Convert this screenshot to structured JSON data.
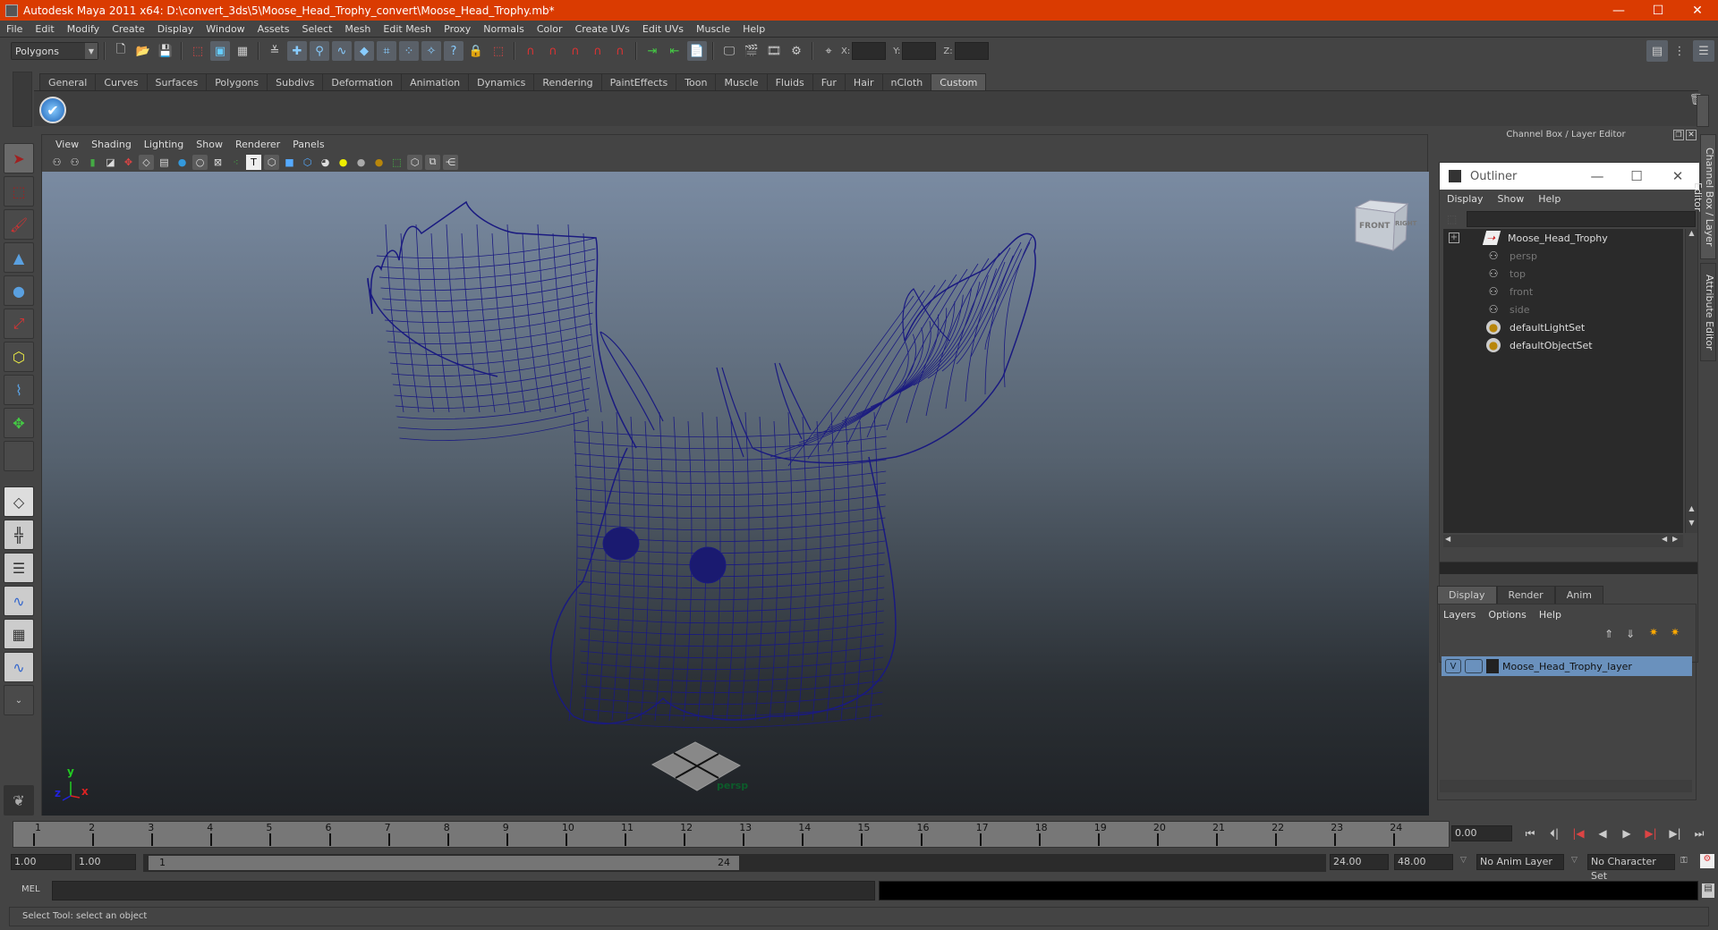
{
  "window": {
    "title": "Autodesk Maya 2011 x64: D:\\convert_3ds\\5\\Moose_Head_Trophy_convert\\Moose_Head_Trophy.mb*",
    "minimize": "—",
    "maximize": "☐",
    "close": "✕"
  },
  "menubar": [
    "File",
    "Edit",
    "Modify",
    "Create",
    "Display",
    "Window",
    "Assets",
    "Select",
    "Mesh",
    "Edit Mesh",
    "Proxy",
    "Normals",
    "Color",
    "Create UVs",
    "Edit UVs",
    "Muscle",
    "Help"
  ],
  "toolbar": {
    "mode": "Polygons",
    "x_label": "X:",
    "y_label": "Y:",
    "z_label": "Z:"
  },
  "shelf": {
    "tabs": [
      "General",
      "Curves",
      "Surfaces",
      "Polygons",
      "Subdivs",
      "Deformation",
      "Animation",
      "Dynamics",
      "Rendering",
      "PaintEffects",
      "Toon",
      "Muscle",
      "Fluids",
      "Fur",
      "Hair",
      "nCloth",
      "Custom"
    ],
    "active_tab": "Custom"
  },
  "viewport": {
    "menus": [
      "View",
      "Shading",
      "Lighting",
      "Show",
      "Renderer",
      "Panels"
    ],
    "camera": "persp",
    "viewcube_front": "FRONT",
    "viewcube_right": "RIGHT",
    "axis_labels": {
      "x": "x",
      "y": "y",
      "z": "z"
    },
    "wire_color": "#1a1a80"
  },
  "rightdock": {
    "header": "Channel Box / Layer Editor",
    "side_tabs": [
      "Channel Box / Layer Editor",
      "Attribute Editor"
    ]
  },
  "outliner": {
    "title": "Outliner",
    "menus": [
      "Display",
      "Show",
      "Help"
    ],
    "items": [
      {
        "name": "Moose_Head_Trophy",
        "icon": "transform-icon",
        "dim": false,
        "expandable": true
      },
      {
        "name": "persp",
        "icon": "camera-icon",
        "dim": true
      },
      {
        "name": "top",
        "icon": "camera-icon",
        "dim": true
      },
      {
        "name": "front",
        "icon": "camera-icon",
        "dim": true
      },
      {
        "name": "side",
        "icon": "camera-icon",
        "dim": true
      },
      {
        "name": "defaultLightSet",
        "icon": "set-icon",
        "dim": false
      },
      {
        "name": "defaultObjectSet",
        "icon": "set-icon",
        "dim": false
      }
    ]
  },
  "layer_editor": {
    "tabs": [
      "Display",
      "Render",
      "Anim"
    ],
    "active_tab": "Display",
    "menus": [
      "Layers",
      "Options",
      "Help"
    ],
    "layers": [
      {
        "visible": "V",
        "name": "Moose_Head_Trophy_layer",
        "color": "#6a91bd"
      }
    ]
  },
  "timeline": {
    "ticks": [
      "1",
      "2",
      "3",
      "4",
      "5",
      "6",
      "7",
      "8",
      "9",
      "10",
      "11",
      "12",
      "13",
      "14",
      "15",
      "16",
      "17",
      "18",
      "19",
      "20",
      "21",
      "22",
      "23",
      "24"
    ],
    "current_time": "0.00",
    "start_time": "1.00",
    "playback_start": "1.00",
    "range_start_label": "1",
    "range_end_label": "24",
    "playback_end": "24.00",
    "end_time": "48.00",
    "anim_layer": "No Anim Layer",
    "character_set": "No Character Set"
  },
  "command_line": {
    "label": "MEL",
    "value": ""
  },
  "status": {
    "help_line": "Select Tool: select an object"
  }
}
